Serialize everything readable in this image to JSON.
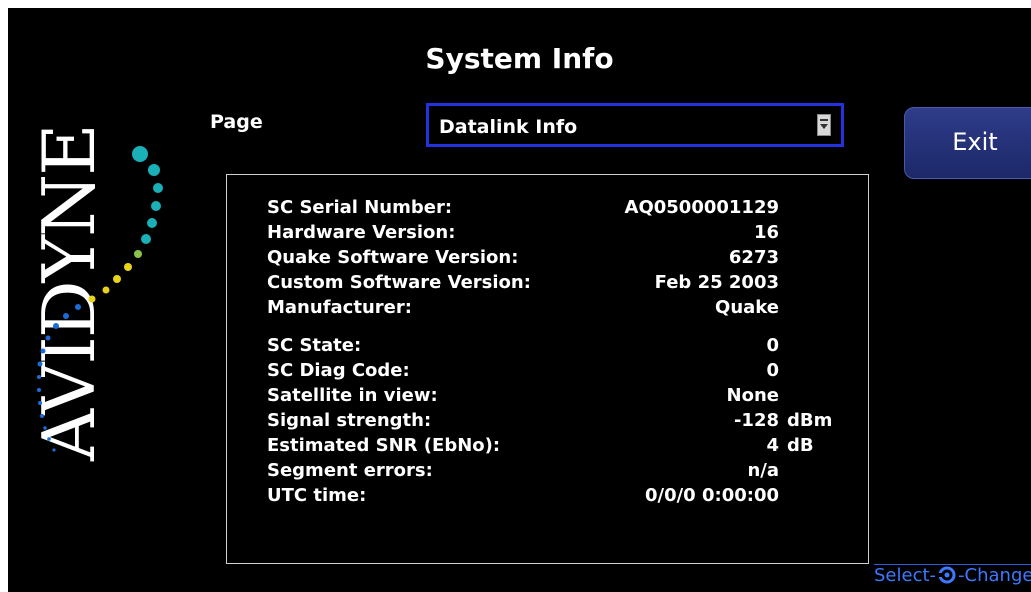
{
  "title": "System Info",
  "page_selector": {
    "label": "Page",
    "selected": "Datalink Info"
  },
  "exit_button": {
    "label": "Exit"
  },
  "logo": {
    "text": "AVIDYNE"
  },
  "info": {
    "rows_group1": [
      {
        "label": "SC Serial Number:",
        "value": "AQ0500001129",
        "unit": ""
      },
      {
        "label": "Hardware Version:",
        "value": "16",
        "unit": ""
      },
      {
        "label": "Quake Software Version:",
        "value": "6273",
        "unit": ""
      },
      {
        "label": "Custom Software Version:",
        "value": "Feb 25 2003",
        "unit": ""
      },
      {
        "label": "Manufacturer:",
        "value": "Quake",
        "unit": ""
      }
    ],
    "rows_group2": [
      {
        "label": "SC State:",
        "value": "0",
        "unit": ""
      },
      {
        "label": "SC Diag Code:",
        "value": "0",
        "unit": ""
      },
      {
        "label": "Satellite in view:",
        "value": "None",
        "unit": ""
      },
      {
        "label": "Signal strength:",
        "value": "-128",
        "unit": "dBm"
      },
      {
        "label": "Estimated SNR (EbNo):",
        "value": "4",
        "unit": "dB"
      },
      {
        "label": "Segment errors:",
        "value": "n/a",
        "unit": ""
      },
      {
        "label": "UTC time:",
        "value": "0/0/0 0:00:00",
        "unit": ""
      }
    ]
  },
  "footer_hint": {
    "left": "Select-",
    "right": "-Change"
  },
  "colors": {
    "background": "#000000",
    "text": "#ffffff",
    "select_border": "#2233dd",
    "exit_button": "#26327a",
    "hint": "#3d78ff",
    "logo_dots": "#1ab0b8"
  },
  "icons": {
    "dropdown": "chevron-down-icon",
    "knob": "rotary-knob-icon"
  }
}
